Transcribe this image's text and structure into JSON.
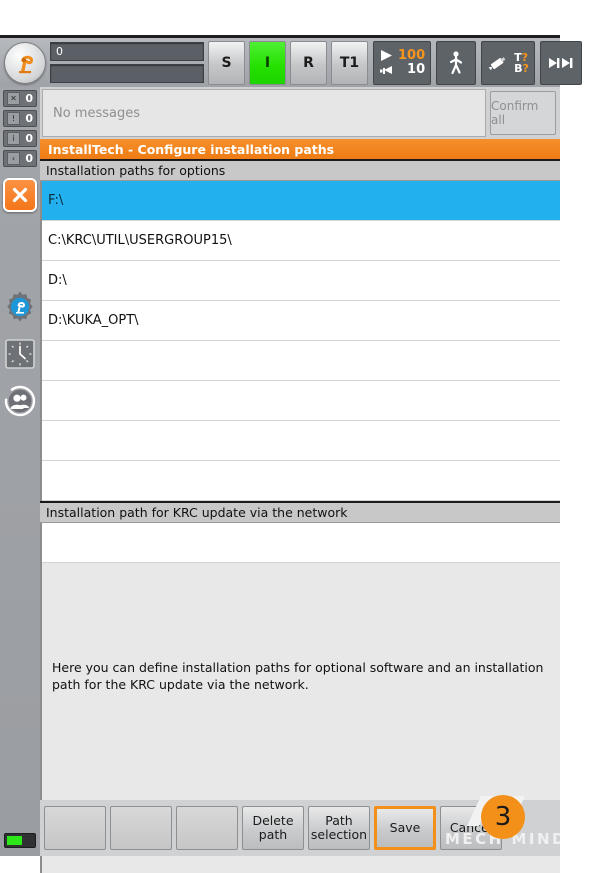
{
  "statusbar": {
    "robot_icon": "robot-arm-icon",
    "field_top_value": "0",
    "field_bottom_value": "",
    "mode_buttons": [
      {
        "label": "S",
        "state": "inactive"
      },
      {
        "label": "I",
        "state": "active"
      },
      {
        "label": "R",
        "state": "inactive"
      },
      {
        "label": "T1",
        "state": "inactive"
      }
    ],
    "override": {
      "program_icon": "play-icon",
      "jog_icon": "hand-jog-icon",
      "program_value": "100",
      "jog_value": "10"
    },
    "jog_mode_icon": "walking-man-icon",
    "tool_base": {
      "icon": "tool-base-icon",
      "tool_label": "T?",
      "base_label": "B?"
    },
    "increment_icon": "increment-arrows-icon"
  },
  "messages": {
    "text": "No messages",
    "confirm_all_label": "Confirm all",
    "counters": [
      {
        "icon": "acknowledge-message-icon",
        "count": "0"
      },
      {
        "icon": "status-message-icon",
        "count": "0"
      },
      {
        "icon": "notification-message-icon",
        "count": "0"
      },
      {
        "icon": "waiting-message-icon",
        "count": "0"
      }
    ]
  },
  "rail": {
    "close_icon": "close-x-icon",
    "icons": [
      {
        "name": "robot-settings-gear-icon"
      },
      {
        "name": "clock-icon"
      },
      {
        "name": "user-group-icon"
      }
    ],
    "battery_icon": "battery-indicator-icon"
  },
  "dialog": {
    "title": "InstallTech - Configure installation paths",
    "sections": [
      {
        "header": "Installation paths for options",
        "rows": [
          {
            "value": "F:\\",
            "selected": true
          },
          {
            "value": "C:\\KRC\\UTIL\\USERGROUP15\\",
            "selected": false
          },
          {
            "value": "D:\\",
            "selected": false
          },
          {
            "value": "D:\\KUKA_OPT\\",
            "selected": false
          },
          {
            "value": "",
            "selected": false
          },
          {
            "value": "",
            "selected": false
          },
          {
            "value": "",
            "selected": false
          },
          {
            "value": "",
            "selected": false
          }
        ]
      },
      {
        "header": "Installation path for KRC update via the network",
        "rows": [
          {
            "value": "",
            "selected": false
          }
        ]
      }
    ],
    "description": "Here you can define installation paths for optional software and an installation path for the KRC update via the network."
  },
  "buttons": {
    "blank1": "",
    "blank2": "",
    "blank3": "",
    "delete_path": "Delete path",
    "path_selection_line1": "Path",
    "path_selection_line2": "selection",
    "save": "Save",
    "cancel": "Cancel"
  },
  "annotation": {
    "step_badge": "3"
  },
  "watermark": {
    "text": "MECH MIND"
  },
  "colors": {
    "accent_orange": "#f3901a",
    "selection_blue": "#23b0ef",
    "active_green": "#24e000"
  }
}
